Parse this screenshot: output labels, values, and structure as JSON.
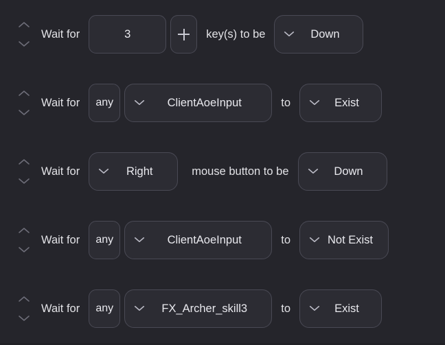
{
  "theme": {
    "background": "#25252b",
    "control_fill": "#2c2c33",
    "control_border": "#4a4a55",
    "text": "#e9e9ee",
    "icon": "#b9b9c4"
  },
  "icons": {
    "chevron_up": "chevron-up-icon",
    "chevron_down": "chevron-down-icon",
    "caret_down": "chevron-down-icon",
    "plus": "plus-icon"
  },
  "rows": [
    {
      "kind": "key-condition",
      "lead_label": "Wait for",
      "count_value": "3",
      "plus_label": "+",
      "mid_label": "key(s) to be",
      "state_value": "Down"
    },
    {
      "kind": "object-condition",
      "lead_label": "Wait for",
      "quantifier_value": "any",
      "target_value": "ClientAoeInput",
      "mid_label": "to",
      "state_value": "Exist"
    },
    {
      "kind": "mouse-condition",
      "lead_label": "Wait for",
      "button_value": "Right",
      "mid_label": "mouse button to be",
      "state_value": "Down"
    },
    {
      "kind": "object-condition",
      "lead_label": "Wait for",
      "quantifier_value": "any",
      "target_value": "ClientAoeInput",
      "mid_label": "to",
      "state_value": "Not Exist"
    },
    {
      "kind": "object-condition",
      "lead_label": "Wait for",
      "quantifier_value": "any",
      "target_value": "FX_Archer_skill3",
      "mid_label": "to",
      "state_value": "Exist"
    }
  ]
}
